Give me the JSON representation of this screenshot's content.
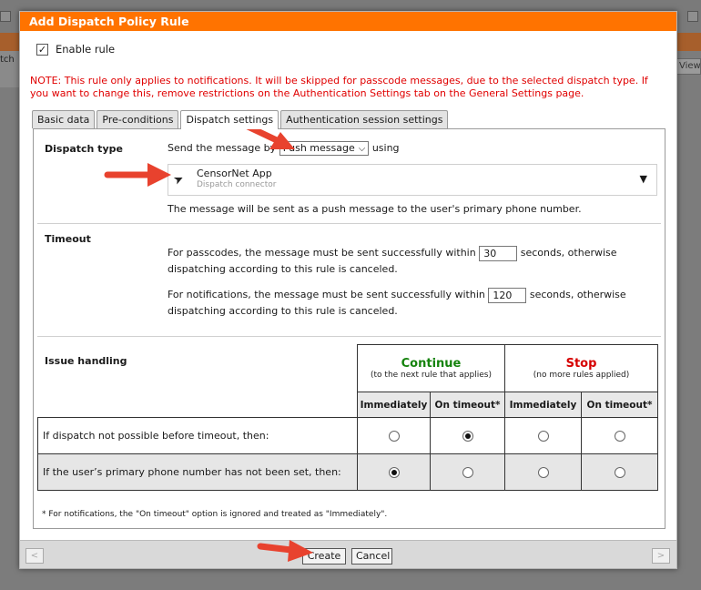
{
  "background": {
    "left_strip_text": "tch",
    "right_button_label": "View"
  },
  "dialog": {
    "title": "Add Dispatch Policy Rule",
    "enable_rule": {
      "label": "Enable rule",
      "checked": true
    },
    "note": "NOTE: This rule only applies to notifications. It will be skipped for passcode messages, due to the selected dispatch type. If you want to change this, remove restrictions on the Authentication Settings tab on the General Settings page.",
    "tabs": [
      {
        "label": "Basic data",
        "active": false
      },
      {
        "label": "Pre-conditions",
        "active": false
      },
      {
        "label": "Dispatch settings",
        "active": true
      },
      {
        "label": "Authentication session settings",
        "active": false
      }
    ],
    "dispatch_type": {
      "heading": "Dispatch type",
      "send_prefix": "Send the message by",
      "method_selected": "Push message",
      "send_suffix": "using",
      "connector_name": "CensorNet App",
      "connector_type": "Dispatch connector",
      "description": "The message will be sent as a push message to the user's primary phone number."
    },
    "timeout": {
      "heading": "Timeout",
      "passcode_prefix": "For passcodes, the message must be sent successfully within",
      "passcode_value": "30",
      "passcode_suffix": "seconds, otherwise",
      "passcode_line2": "dispatching according to this rule is canceled.",
      "notification_prefix": "For notifications, the message must be sent successfully within",
      "notification_value": "120",
      "notification_suffix": "seconds, otherwise",
      "notification_line2": "dispatching according to this rule is canceled."
    },
    "issue_handling": {
      "heading": "Issue handling",
      "continue_title": "Continue",
      "continue_sub": "(to the next rule that applies)",
      "stop_title": "Stop",
      "stop_sub": "(no more rules applied)",
      "columns": [
        "Immediately",
        "On timeout*",
        "Immediately",
        "On timeout*"
      ],
      "rows": [
        {
          "label": "If dispatch not possible before timeout, then:",
          "selected": 1
        },
        {
          "label": "If the user’s primary phone number has not been set, then:",
          "selected": 0
        }
      ],
      "footnote": "* For notifications, the \"On timeout\" option is ignored and treated as \"Immediately\"."
    },
    "footer": {
      "prev": "<",
      "next": ">",
      "create": "Create",
      "cancel": "Cancel"
    }
  },
  "colors": {
    "title_bar": "#ff7300",
    "note_text": "#e00000",
    "continue": "#15830d",
    "stop": "#d60000",
    "annotation_arrow": "#e8422e"
  }
}
